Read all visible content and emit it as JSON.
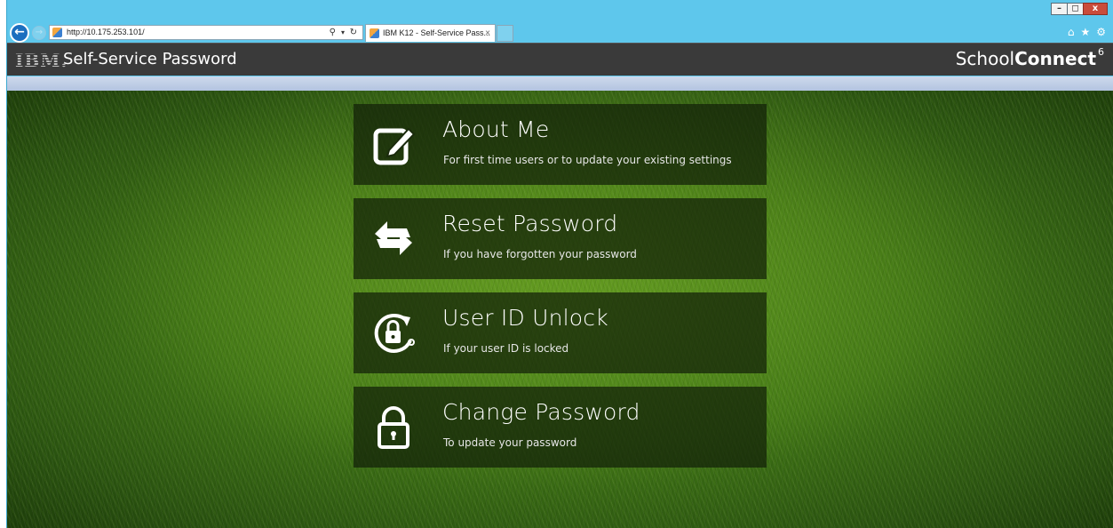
{
  "browser": {
    "window_controls": {
      "minimize": "–",
      "maximize": "◻",
      "close": "x"
    },
    "address": {
      "url": "http://10.175.253.101/"
    },
    "tab": {
      "title": "IBM K12 - Self-Service Pass...",
      "close": "×"
    }
  },
  "header": {
    "logo": "IBM.",
    "title": "Self-Service Password",
    "brand_prefix": "School",
    "brand_bold": "Connect",
    "brand_version": "6"
  },
  "menu": [
    {
      "title": "About Me",
      "subtitle": "For first time users or to update your existing settings",
      "icon": "edit-icon"
    },
    {
      "title": "Reset Password",
      "subtitle": "If you have forgotten your password",
      "icon": "swap-arrows-icon"
    },
    {
      "title": "User ID Unlock",
      "subtitle": "If your user ID is locked",
      "icon": "unlock-rotate-icon"
    },
    {
      "title": "Change Password",
      "subtitle": "To update your password",
      "icon": "padlock-icon"
    }
  ],
  "colors": {
    "browser_frame": "#5ec7ec",
    "header_bg": "#3a3a3a",
    "tile_bg": "rgba(18,32,8,0.72)",
    "grass": "#3f7415"
  }
}
